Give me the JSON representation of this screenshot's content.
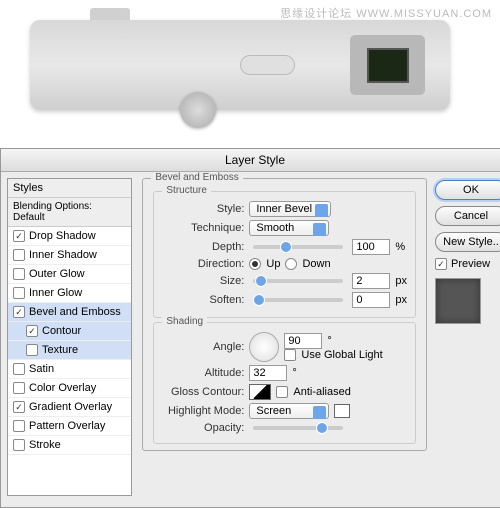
{
  "watermark": "思缘设计论坛 WWW.MISSYUAN.COM",
  "dialog": {
    "title": "Layer Style",
    "sidebar_header": "Styles",
    "blending_label": "Blending Options: Default",
    "items": [
      {
        "label": "Drop Shadow",
        "checked": true
      },
      {
        "label": "Inner Shadow",
        "checked": false
      },
      {
        "label": "Outer Glow",
        "checked": false
      },
      {
        "label": "Inner Glow",
        "checked": false
      },
      {
        "label": "Bevel and Emboss",
        "checked": true,
        "selected": true
      },
      {
        "label": "Contour",
        "checked": true,
        "indent": true,
        "selected": true
      },
      {
        "label": "Texture",
        "checked": false,
        "indent": true,
        "selected": true
      },
      {
        "label": "Satin",
        "checked": false
      },
      {
        "label": "Color Overlay",
        "checked": false
      },
      {
        "label": "Gradient Overlay",
        "checked": true
      },
      {
        "label": "Pattern Overlay",
        "checked": false
      },
      {
        "label": "Stroke",
        "checked": false
      }
    ]
  },
  "panel": {
    "title": "Bevel and Emboss",
    "structure": {
      "legend": "Structure",
      "style_label": "Style:",
      "style_value": "Inner Bevel",
      "technique_label": "Technique:",
      "technique_value": "Smooth",
      "depth_label": "Depth:",
      "depth_value": "100",
      "depth_unit": "%",
      "direction_label": "Direction:",
      "up": "Up",
      "down": "Down",
      "size_label": "Size:",
      "size_value": "2",
      "size_unit": "px",
      "soften_label": "Soften:",
      "soften_value": "0",
      "soften_unit": "px"
    },
    "shading": {
      "legend": "Shading",
      "angle_label": "Angle:",
      "angle_value": "90",
      "angle_unit": "°",
      "global_light": "Use Global Light",
      "altitude_label": "Altitude:",
      "altitude_value": "32",
      "altitude_unit": "°",
      "gloss_label": "Gloss Contour:",
      "antialiased": "Anti-aliased",
      "highlight_label": "Highlight Mode:",
      "highlight_value": "Screen",
      "opacity_label": "Opacity:"
    }
  },
  "buttons": {
    "ok": "OK",
    "cancel": "Cancel",
    "newstyle": "New Style..",
    "preview": "Preview"
  }
}
